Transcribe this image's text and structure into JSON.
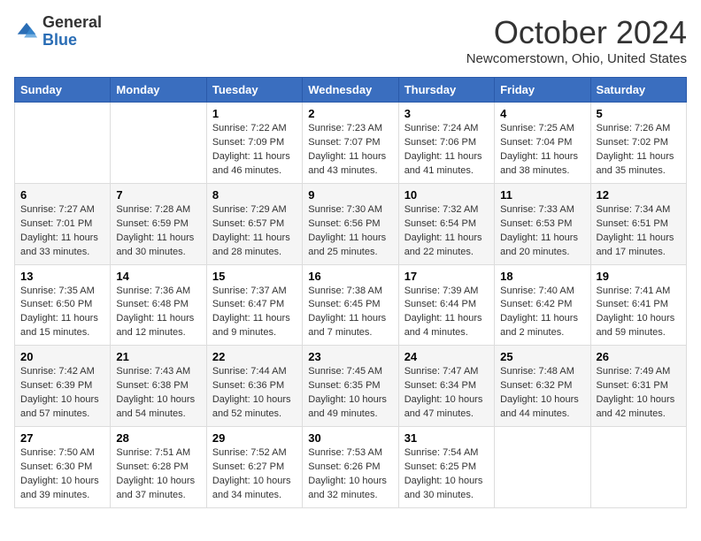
{
  "header": {
    "logo": {
      "line1": "General",
      "line2": "Blue"
    },
    "title": "October 2024",
    "location": "Newcomerstown, Ohio, United States"
  },
  "weekdays": [
    "Sunday",
    "Monday",
    "Tuesday",
    "Wednesday",
    "Thursday",
    "Friday",
    "Saturday"
  ],
  "weeks": [
    [
      {
        "day": "",
        "info": ""
      },
      {
        "day": "",
        "info": ""
      },
      {
        "day": "1",
        "info": "Sunrise: 7:22 AM\nSunset: 7:09 PM\nDaylight: 11 hours and 46 minutes."
      },
      {
        "day": "2",
        "info": "Sunrise: 7:23 AM\nSunset: 7:07 PM\nDaylight: 11 hours and 43 minutes."
      },
      {
        "day": "3",
        "info": "Sunrise: 7:24 AM\nSunset: 7:06 PM\nDaylight: 11 hours and 41 minutes."
      },
      {
        "day": "4",
        "info": "Sunrise: 7:25 AM\nSunset: 7:04 PM\nDaylight: 11 hours and 38 minutes."
      },
      {
        "day": "5",
        "info": "Sunrise: 7:26 AM\nSunset: 7:02 PM\nDaylight: 11 hours and 35 minutes."
      }
    ],
    [
      {
        "day": "6",
        "info": "Sunrise: 7:27 AM\nSunset: 7:01 PM\nDaylight: 11 hours and 33 minutes."
      },
      {
        "day": "7",
        "info": "Sunrise: 7:28 AM\nSunset: 6:59 PM\nDaylight: 11 hours and 30 minutes."
      },
      {
        "day": "8",
        "info": "Sunrise: 7:29 AM\nSunset: 6:57 PM\nDaylight: 11 hours and 28 minutes."
      },
      {
        "day": "9",
        "info": "Sunrise: 7:30 AM\nSunset: 6:56 PM\nDaylight: 11 hours and 25 minutes."
      },
      {
        "day": "10",
        "info": "Sunrise: 7:32 AM\nSunset: 6:54 PM\nDaylight: 11 hours and 22 minutes."
      },
      {
        "day": "11",
        "info": "Sunrise: 7:33 AM\nSunset: 6:53 PM\nDaylight: 11 hours and 20 minutes."
      },
      {
        "day": "12",
        "info": "Sunrise: 7:34 AM\nSunset: 6:51 PM\nDaylight: 11 hours and 17 minutes."
      }
    ],
    [
      {
        "day": "13",
        "info": "Sunrise: 7:35 AM\nSunset: 6:50 PM\nDaylight: 11 hours and 15 minutes."
      },
      {
        "day": "14",
        "info": "Sunrise: 7:36 AM\nSunset: 6:48 PM\nDaylight: 11 hours and 12 minutes."
      },
      {
        "day": "15",
        "info": "Sunrise: 7:37 AM\nSunset: 6:47 PM\nDaylight: 11 hours and 9 minutes."
      },
      {
        "day": "16",
        "info": "Sunrise: 7:38 AM\nSunset: 6:45 PM\nDaylight: 11 hours and 7 minutes."
      },
      {
        "day": "17",
        "info": "Sunrise: 7:39 AM\nSunset: 6:44 PM\nDaylight: 11 hours and 4 minutes."
      },
      {
        "day": "18",
        "info": "Sunrise: 7:40 AM\nSunset: 6:42 PM\nDaylight: 11 hours and 2 minutes."
      },
      {
        "day": "19",
        "info": "Sunrise: 7:41 AM\nSunset: 6:41 PM\nDaylight: 10 hours and 59 minutes."
      }
    ],
    [
      {
        "day": "20",
        "info": "Sunrise: 7:42 AM\nSunset: 6:39 PM\nDaylight: 10 hours and 57 minutes."
      },
      {
        "day": "21",
        "info": "Sunrise: 7:43 AM\nSunset: 6:38 PM\nDaylight: 10 hours and 54 minutes."
      },
      {
        "day": "22",
        "info": "Sunrise: 7:44 AM\nSunset: 6:36 PM\nDaylight: 10 hours and 52 minutes."
      },
      {
        "day": "23",
        "info": "Sunrise: 7:45 AM\nSunset: 6:35 PM\nDaylight: 10 hours and 49 minutes."
      },
      {
        "day": "24",
        "info": "Sunrise: 7:47 AM\nSunset: 6:34 PM\nDaylight: 10 hours and 47 minutes."
      },
      {
        "day": "25",
        "info": "Sunrise: 7:48 AM\nSunset: 6:32 PM\nDaylight: 10 hours and 44 minutes."
      },
      {
        "day": "26",
        "info": "Sunrise: 7:49 AM\nSunset: 6:31 PM\nDaylight: 10 hours and 42 minutes."
      }
    ],
    [
      {
        "day": "27",
        "info": "Sunrise: 7:50 AM\nSunset: 6:30 PM\nDaylight: 10 hours and 39 minutes."
      },
      {
        "day": "28",
        "info": "Sunrise: 7:51 AM\nSunset: 6:28 PM\nDaylight: 10 hours and 37 minutes."
      },
      {
        "day": "29",
        "info": "Sunrise: 7:52 AM\nSunset: 6:27 PM\nDaylight: 10 hours and 34 minutes."
      },
      {
        "day": "30",
        "info": "Sunrise: 7:53 AM\nSunset: 6:26 PM\nDaylight: 10 hours and 32 minutes."
      },
      {
        "day": "31",
        "info": "Sunrise: 7:54 AM\nSunset: 6:25 PM\nDaylight: 10 hours and 30 minutes."
      },
      {
        "day": "",
        "info": ""
      },
      {
        "day": "",
        "info": ""
      }
    ]
  ]
}
